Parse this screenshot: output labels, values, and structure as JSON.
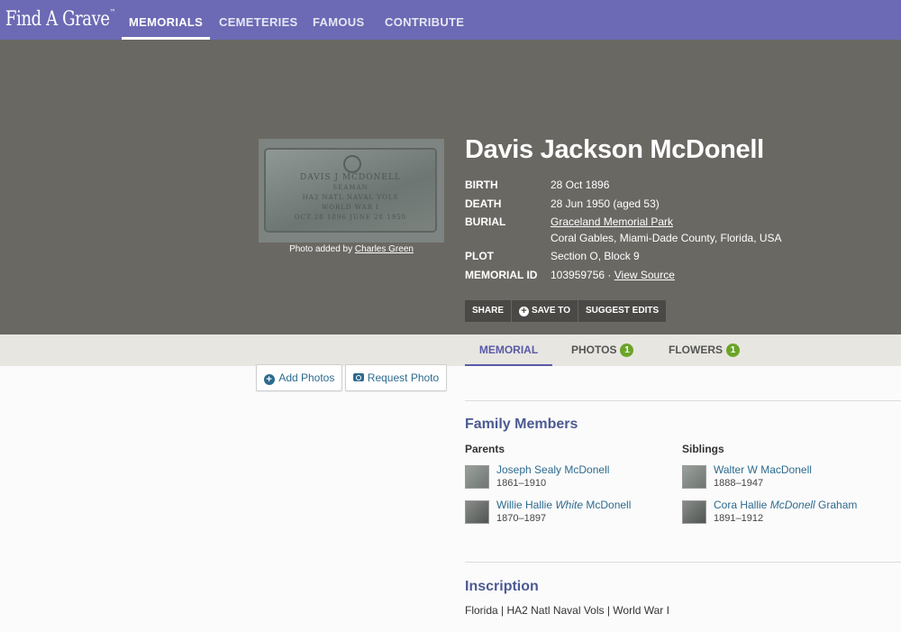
{
  "nav": {
    "logo": "Find A Grave",
    "logo_mark": "™",
    "items": [
      "MEMORIALS",
      "CEMETERIES",
      "FAMOUS",
      "CONTRIBUTE"
    ]
  },
  "photo": {
    "stone_lines": [
      "DAVIS J MCDONELL",
      "SEAMAN",
      "HA2 NATL NAVAL VOLS",
      "WORLD WAR I",
      "OCT 28 1896   JUNE 28 1950"
    ],
    "caption_prefix": "Photo added by",
    "caption_author": "Charles Green"
  },
  "memorial": {
    "name": "Davis Jackson McDonell",
    "birth_label": "BIRTH",
    "birth_value": "28 Oct 1896",
    "death_label": "DEATH",
    "death_value": "28 Jun 1950 (aged 53)",
    "burial_label": "BURIAL",
    "burial_cemetery": "Graceland Memorial Park",
    "burial_location": "Coral Gables, Miami-Dade County, Florida, USA",
    "plot_label": "PLOT",
    "plot_value": "Section O, Block 9",
    "memorial_id_label": "MEMORIAL ID",
    "memorial_id_value": "103959756 ·",
    "view_source": "View Source"
  },
  "actions": {
    "share": "SHARE",
    "save_to": "SAVE TO",
    "suggest_edits": "SUGGEST EDITS"
  },
  "tabs": {
    "memorial": "MEMORIAL",
    "photos": "PHOTOS",
    "photos_count": "1",
    "flowers": "FLOWERS",
    "flowers_count": "1"
  },
  "buttons": {
    "add_photos": "Add Photos",
    "request_photo": "Request Photo"
  },
  "family": {
    "title": "Family Members",
    "parents_label": "Parents",
    "siblings_label": "Siblings",
    "parents": [
      {
        "first": "Joseph Sealy McDonell",
        "middle_italic": "",
        "last": "",
        "dates": "1861–1910"
      },
      {
        "first": "Willie Hallie ",
        "middle_italic": "White",
        "last": " McDonell",
        "dates": "1870–1897"
      }
    ],
    "siblings": [
      {
        "first": "Walter W MacDonell",
        "middle_italic": "",
        "last": "",
        "dates": "1888–1947"
      },
      {
        "first": "Cora Hallie ",
        "middle_italic": "McDonell",
        "last": " Graham",
        "dates": "1891–1912"
      }
    ]
  },
  "inscription": {
    "title": "Inscription",
    "text": "Florida | HA2 Natl Naval Vols | World War I"
  }
}
